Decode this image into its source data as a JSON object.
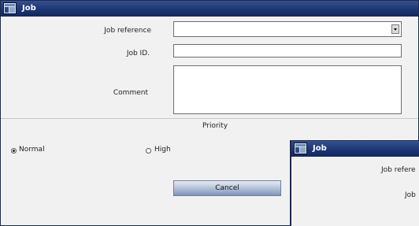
{
  "main_window": {
    "title": "Job",
    "job_reference_label": "Job reference",
    "job_id_label": "Job ID.",
    "comment_label": "Comment",
    "job_reference_value": "",
    "job_id_value": "",
    "comment_value": "",
    "priority_heading": "Priority",
    "priority_options": [
      {
        "label": "Normal",
        "selected": true
      },
      {
        "label": "High",
        "selected": false
      }
    ],
    "cancel_label": "Cancel"
  },
  "overlay_window": {
    "title": "Job",
    "job_reference_label_partial": "Job refere",
    "job_id_label_partial": "Job"
  },
  "colors": {
    "titlebar": "#1d3674",
    "window_bg": "#f1f1f1",
    "button_gradient_bottom": "#7f95b8"
  },
  "icons": {
    "window_icon": "job-window-icon",
    "dropdown": "chevron-down-icon"
  }
}
